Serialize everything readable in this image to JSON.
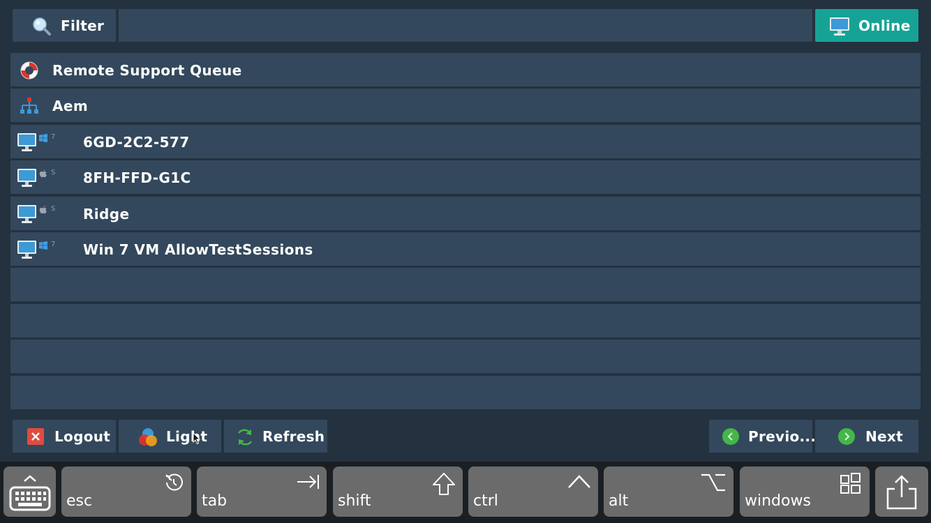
{
  "header": {
    "filter_label": "Filter",
    "filter_value": "",
    "online_label": "Online",
    "online_color": "#16a396"
  },
  "list": {
    "groups": [
      {
        "icon": "lifebuoy-icon",
        "label": "Remote Support Queue"
      },
      {
        "icon": "hierarchy-icon",
        "label": "Aem"
      }
    ],
    "devices": [
      {
        "os": "windows",
        "os_version": "7",
        "label": "6GD-2C2-577"
      },
      {
        "os": "apple",
        "os_version": "S",
        "label": "8FH-FFD-G1C"
      },
      {
        "os": "apple",
        "os_version": "S",
        "label": "Ridge"
      },
      {
        "os": "windows",
        "os_version": "7",
        "label": "Win 7 VM AllowTestSessions"
      }
    ]
  },
  "footer": {
    "logout_label": "Logout",
    "light_label": "Light",
    "refresh_label": "Refresh",
    "previous_label": "Previo...",
    "next_label": "Next"
  },
  "keyboard": {
    "esc": "esc",
    "tab": "tab",
    "shift": "shift",
    "ctrl": "ctrl",
    "alt": "alt",
    "windows": "windows"
  }
}
